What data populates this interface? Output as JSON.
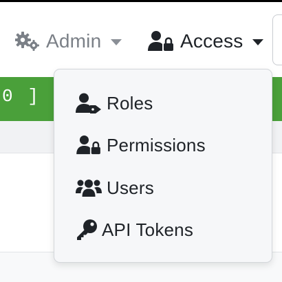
{
  "nav": {
    "admin_label": "Admin",
    "admin_icon": "gears-icon",
    "access_label": "Access",
    "access_icon": "user-lock-icon"
  },
  "content": {
    "green_bar_text": "0 ]",
    "green_bar_color": "#4aa03a"
  },
  "access_menu": {
    "items": [
      {
        "label": "Roles",
        "icon": "user-tag-icon"
      },
      {
        "label": "Permissions",
        "icon": "user-lock-icon"
      },
      {
        "label": "Users",
        "icon": "users-icon"
      },
      {
        "label": "API Tokens",
        "icon": "key-icon"
      }
    ]
  },
  "colors": {
    "text_dark": "#1f2328",
    "text_muted": "#7b8087",
    "menu_bg": "#f6f7f9"
  }
}
